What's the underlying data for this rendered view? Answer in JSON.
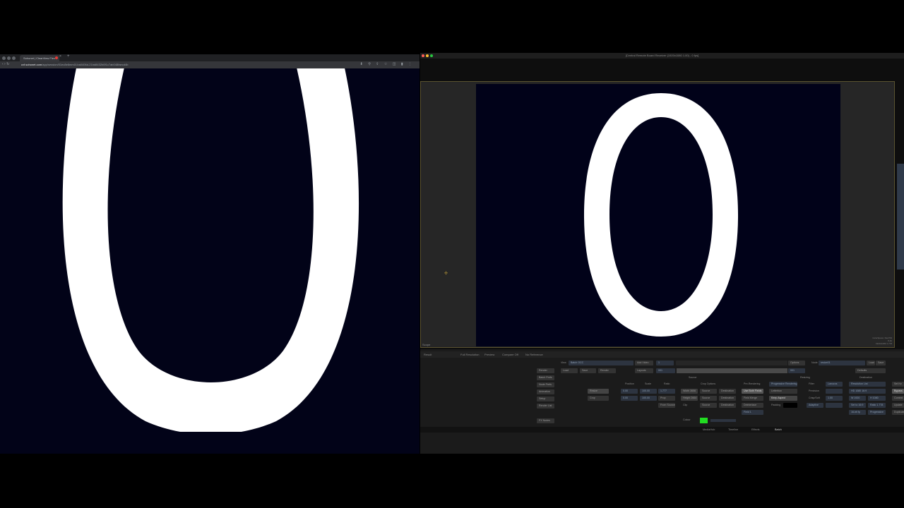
{
  "browser": {
    "tab_title": "Sohonet | ClearView Flex",
    "tab_close": "×",
    "new_tab": "+",
    "url_host": "cvf.sohonet.com",
    "url_path": "/app/session/01ec8e6mm1f-ba0406d-21bd8432b0f1c7ab048faecd4b",
    "nav_icons": "‹ › ↻",
    "toolbar_icons": "⬇ ⚲ ⇪ ☆ ◫ ▮ ⋮",
    "stream_glyph": "0"
  },
  "app": {
    "window_title": "[Central Remote Board Receiver (1920x1080 1.00) - 0 fps]",
    "viewer_glyph": "0",
    "viewer_cursor": "✢",
    "viewer_info_line1": "ColorSpace: Rec709",
    "viewer_info_line2": "8-bit",
    "viewer_info_line3": "1920x1080 1.778",
    "viewer_label": "Scope",
    "top_row": {
      "result_label": "Result",
      "full_resolution": "Full Resolution",
      "preview": "Preview",
      "compare_off": "Compare Off",
      "no_reference": "No Reference"
    },
    "left_buttons": [
      "Render",
      "Batch Prefs",
      "Node Prefs",
      "Animation",
      "Setup",
      "Render List",
      "FX Nodes"
    ],
    "view_label": "View",
    "view_value": "Batch OCC",
    "add_video": "Add Video",
    "frame_value": "1",
    "options": "Options",
    "node_label": "Node",
    "node_value": "resize01",
    "load": "Load",
    "save": "Save",
    "defaults": "Defaults",
    "load_btn": "Load",
    "save_btn": "Save",
    "render_btn": "Render",
    "layouts_btn": "Layouts",
    "timeline_start": "001",
    "timeline_end": "001",
    "source_title": "Source",
    "resizing_title": "Resizing",
    "destination_title": "Destination",
    "position_label": "Position",
    "scale_label": "Scale",
    "ratio_label": "Ratio",
    "resize_btn": "Resize",
    "crop_btn": "Crop",
    "pos_x": "0.00",
    "pos_y": "0.00",
    "scale_x": "100.00",
    "scale_y": "100.00",
    "ratio_value": "1.777",
    "prop_btn": "Prop",
    "from_source": "From Source",
    "crop_options": "Crop Options",
    "width_value": "Width 3656",
    "height_value": "Height 2664",
    "clip_label": "Clip",
    "source_btn": "Source",
    "destination_btn": "Destination",
    "pre_rendering": "Pre-Rendering",
    "use_both_fields": "Use Both Fields",
    "field_merge": "Field Merge",
    "deinterlace": "Deinterlace",
    "field1": "Field 1",
    "progressive": "Progressive Rendering",
    "letterbox": "Letterbox",
    "keep_aspect": "Keep Aspect",
    "padding": "Padding",
    "filter_label": "Filter",
    "filter_value": "Lanczos",
    "precision_label": "Precision",
    "crisp_soft": "Crisp/Soft",
    "crisp_value": "1.00",
    "adaptive": "Adaptive",
    "resolution_list": "Resolution List",
    "hd_1080": "HD 1080 16:9",
    "w_value": "W 1920",
    "h_value": "H 1080",
    "set_to_16_9": "Set to 16:9",
    "ratio_1778": "Ratio 1.778",
    "8bit": "16-bit fp",
    "progressive_btn": "Progressive",
    "colour_label": "Colour",
    "bottom_tabs": [
      "MediaHub",
      "Timeline",
      "Effects",
      "Batch"
    ],
    "active_tab": "Batch",
    "right_cut": [
      "Set Ke",
      "Bypass",
      "Context",
      "Update",
      "Duplicate"
    ]
  },
  "colors": {
    "background": "#020318",
    "glyph": "#ffffff",
    "colour_swatch": "#22dd22"
  }
}
